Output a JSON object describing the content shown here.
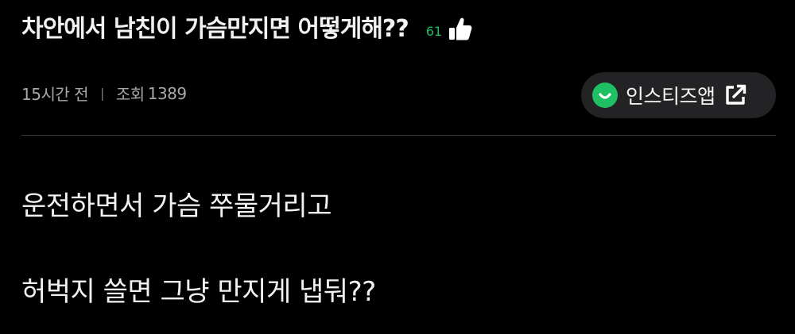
{
  "post": {
    "title": "차안에서 남친이 가슴만지면 어떻게해??",
    "like_count": "61",
    "time_ago": "15시간 전",
    "separator": "|",
    "views_label": "조회",
    "views_count": "1389",
    "app_button_label": "인스티즈앱",
    "body_lines": [
      "운전하면서 가슴 쭈물거리고",
      "허벅지 쓸면 그냥 만지게 냅둬??"
    ]
  },
  "icons": {
    "like": "thumbs-up-icon",
    "app_logo": "instiz-logo-icon",
    "external": "external-link-icon"
  },
  "colors": {
    "background": "#000000",
    "accent_green": "#1fbf63",
    "button_bg": "#232325",
    "meta_text": "#a8a8a8"
  }
}
